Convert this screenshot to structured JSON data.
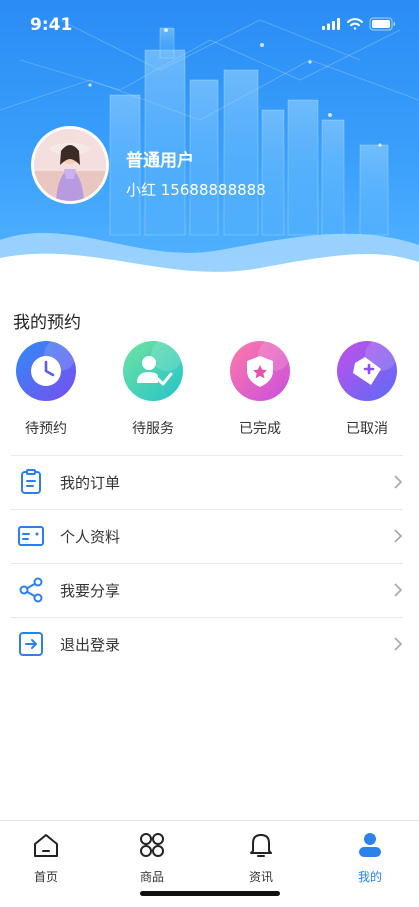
{
  "status_bar": {
    "time": "9:41"
  },
  "profile": {
    "role": "普通用户",
    "name_phone": "小红 15688888888"
  },
  "reservations": {
    "title": "我的预约",
    "items": [
      {
        "label": "待预约",
        "icon": "clock-icon",
        "color": "#4a63f0"
      },
      {
        "label": "待服务",
        "icon": "user-check-icon",
        "color": "#3fcf9f"
      },
      {
        "label": "已完成",
        "icon": "star-shield-icon",
        "color": "#e94aa5"
      },
      {
        "label": "已取消",
        "icon": "tag-plus-icon",
        "color": "#8a4ff0"
      }
    ]
  },
  "menu": [
    {
      "label": "我的订单",
      "icon": "clipboard-icon"
    },
    {
      "label": "个人资料",
      "icon": "id-card-icon"
    },
    {
      "label": "我要分享",
      "icon": "share-icon"
    },
    {
      "label": "退出登录",
      "icon": "logout-icon"
    }
  ],
  "tabbar": {
    "active": "我的",
    "active_color": "#2a82ea",
    "items": [
      {
        "label": "首页",
        "icon": "home-icon"
      },
      {
        "label": "商品",
        "icon": "grid-icon"
      },
      {
        "label": "资讯",
        "icon": "bell-icon"
      },
      {
        "label": "我的",
        "icon": "person-icon"
      }
    ]
  }
}
